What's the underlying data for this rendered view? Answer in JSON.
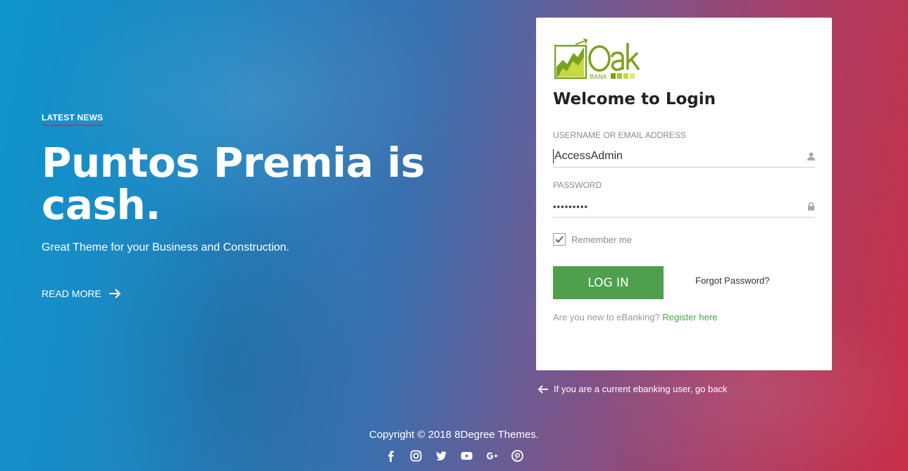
{
  "hero": {
    "eyebrow": "LATEST NEWS",
    "headline": "Puntos Premia is cash.",
    "subtitle": "Great Theme for your Business and Construction.",
    "read_more": "READ MORE",
    "read_more_icon": "arrow-right-icon"
  },
  "login": {
    "logo_text": "Oak",
    "logo_subtext": "BANK",
    "title": "Welcome to Login",
    "username_label": "USERNAME OR EMAIL ADDRESS",
    "username_value": "AccessAdmin",
    "username_icon": "user-icon",
    "password_label": "PASSWORD",
    "password_value": "•••••••••",
    "password_icon": "lock-icon",
    "remember_label": "Remember me",
    "remember_checked": true,
    "login_button": "LOG IN",
    "forgot_password": "Forgot Password?",
    "register_prompt": "Are you new to eBanking?",
    "register_link": "Register here"
  },
  "back_link": "If you are a current ebanking user, go back",
  "footer": {
    "copyright": "Copyright © 2018 8Degree Themes.",
    "socials": [
      "facebook-icon",
      "instagram-icon",
      "twitter-icon",
      "youtube-icon",
      "google-plus-icon",
      "pinterest-icon"
    ]
  },
  "colors": {
    "accent_green": "#4ea04e",
    "eyebrow_underline": "#d8285a",
    "gradient_start": "#0f95cc",
    "gradient_end": "#c93048"
  }
}
